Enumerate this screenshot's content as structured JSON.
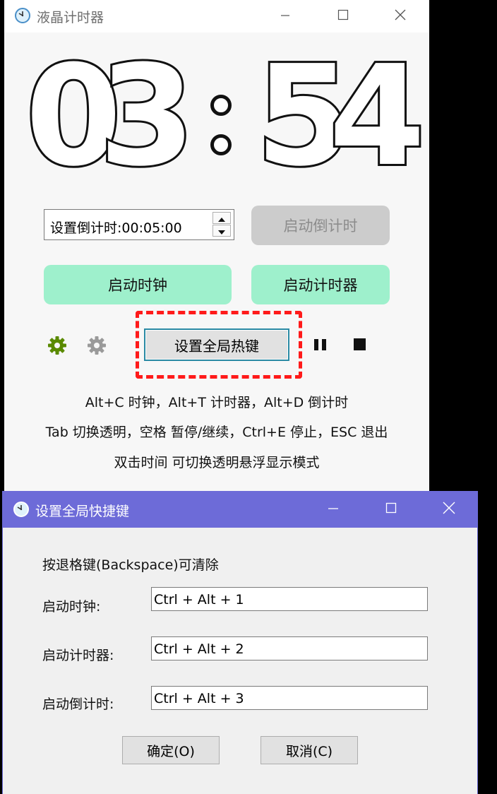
{
  "main_window": {
    "title": "液晶计时器",
    "display": {
      "d1": "0",
      "d2": "3",
      "d3": "5",
      "d4": "4"
    },
    "countdown_input": "设置倒计时:00:05:00",
    "start_countdown_label": "启动倒计时",
    "start_clock_label": "启动时钟",
    "start_timer_label": "启动计时器",
    "set_hotkey_label": "设置全局热键",
    "hints": [
      "Alt+C 时钟，Alt+T 计时器，Alt+D 倒计时",
      "Tab 切换透明，空格 暂停/继续，Ctrl+E 停止，ESC 退出",
      "双击时间 可切换透明悬浮显示模式"
    ],
    "colors": {
      "accent_green": "#5a8a00",
      "mint": "#9ef0cc",
      "highlight_red": "#ff1a1a"
    }
  },
  "dialog": {
    "title": "设置全局快捷键",
    "instruction": "按退格键(Backspace)可清除",
    "rows": [
      {
        "label": "启动时钟:",
        "value": "Ctrl + Alt + 1"
      },
      {
        "label": "启动计时器:",
        "value": "Ctrl + Alt + 2"
      },
      {
        "label": "启动倒计时:",
        "value": "Ctrl + Alt + 3"
      }
    ],
    "ok_label": "确定(O)",
    "cancel_label": "取消(C)",
    "titlebar_color": "#6d6bd8"
  }
}
